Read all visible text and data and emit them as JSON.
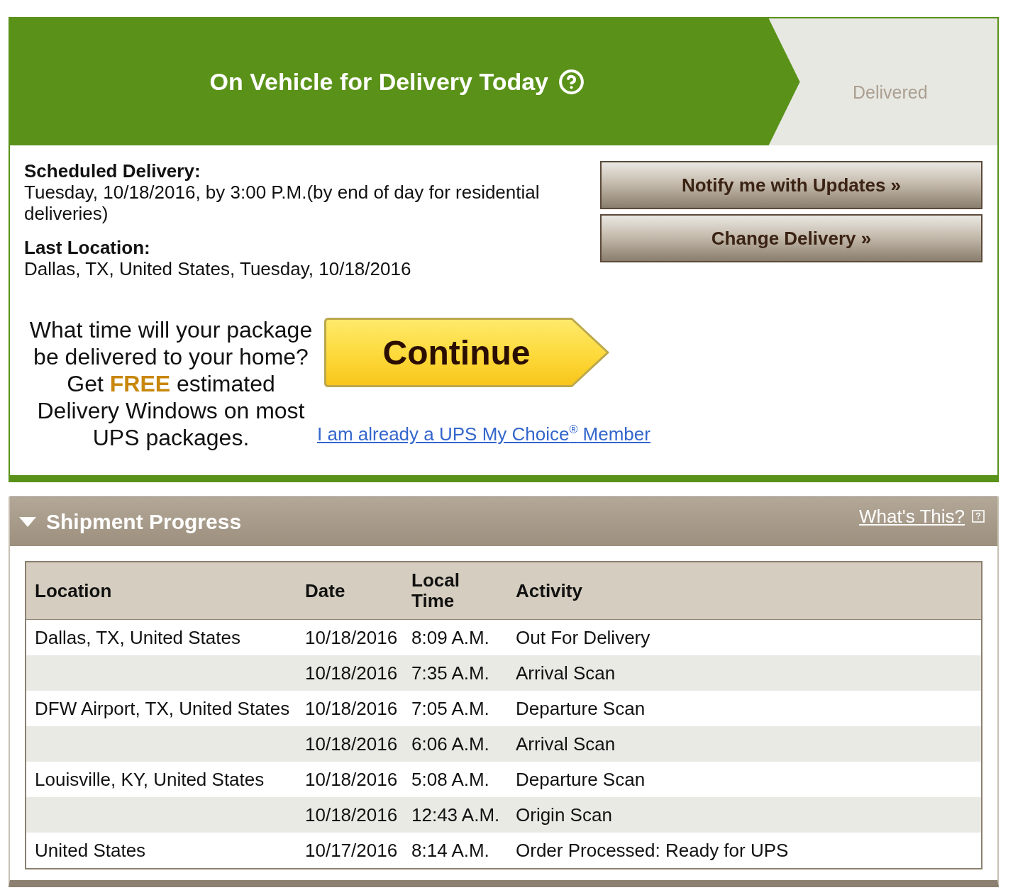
{
  "status_tracker": {
    "steps": [
      {
        "label": "On Vehicle for Delivery Today",
        "selected": true,
        "help_icon": true
      },
      {
        "label": "Delivered",
        "selected": false
      }
    ]
  },
  "delivery_info": [
    {
      "label": "Scheduled Delivery:",
      "value": "Tuesday, 10/18/2016, by 3:00 P.M.(by end of day for residential deliveries)"
    },
    {
      "label": "Last Location:",
      "value": "Dallas, TX, United States, Tuesday, 10/18/2016"
    }
  ],
  "actions": [
    "Notify me with Updates »",
    "Change Delivery »"
  ],
  "promo": {
    "text": "What time will your package be delivered to your home? Get **FREE** estimated Delivery Windows on most UPS packages.",
    "button": "Continue",
    "member_link": "I am already a UPS My Choice$^{®}$ Member"
  },
  "shipment_progress": {
    "title": "Shipment Progress",
    "expanded": true,
    "help_link": "What's This?",
    "table": {
      "columns": [
        "Location",
        "Date",
        "Local Time",
        "Activity"
      ],
      "rows": [
        {
          "location": "Dallas, TX, United States",
          "date": "10/18/2016",
          "time": "8:09 A.M.",
          "activity": "Out For Delivery"
        },
        {
          "date": "10/18/2016",
          "time": "7:35 A.M.",
          "activity": "Arrival Scan"
        },
        {
          "location": "DFW Airport, TX, United States",
          "date": "10/18/2016",
          "time": "7:05 A.M.",
          "activity": "Departure Scan"
        },
        {
          "date": "10/18/2016",
          "time": "6:06 A.M.",
          "activity": "Arrival Scan"
        },
        {
          "location": "Louisville, KY, United States",
          "date": "10/18/2016",
          "time": "5:08 A.M.",
          "activity": "Departure Scan"
        },
        {
          "date": "10/18/2016",
          "time": "12:43 A.M.",
          "activity": "Origin Scan"
        },
        {
          "location": "United States",
          "date": "10/17/2016",
          "time": "8:14 A.M.",
          "activity": "Order Processed: Ready for UPS"
        }
      ]
    }
  }
}
